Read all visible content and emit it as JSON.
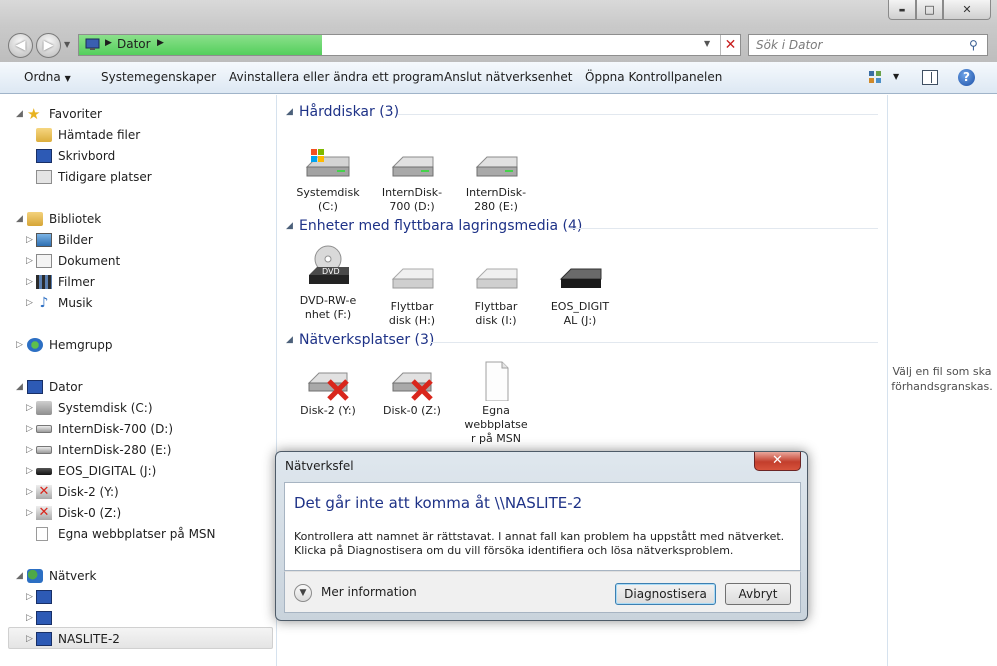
{
  "window": {
    "title": "",
    "buttons": {
      "minimize": "▬",
      "maximize": "□",
      "close": "✕"
    }
  },
  "address": {
    "path": [
      "Dator"
    ],
    "search_placeholder": "Sök i Dator"
  },
  "toolbar": {
    "organize": "Ordna",
    "items": [
      "Systemegenskaper",
      "Avinstallera eller ändra ett program",
      "Anslut nätverksenhet",
      "Öppna Kontrollpanelen"
    ]
  },
  "nav": {
    "favorites": {
      "label": "Favoriter",
      "items": [
        "Hämtade filer",
        "Skrivbord",
        "Tidigare platser"
      ]
    },
    "libraries": {
      "label": "Bibliotek",
      "items": [
        "Bilder",
        "Dokument",
        "Filmer",
        "Musik"
      ]
    },
    "homegroup": {
      "label": "Hemgrupp"
    },
    "computer": {
      "label": "Dator",
      "items": [
        "Systemdisk (C:)",
        "InternDisk-700 (D:)",
        "InternDisk-280 (E:)",
        "EOS_DIGITAL (J:)",
        "Disk-2 (Y:)",
        "Disk-0 (Z:)",
        "Egna webbplatser på MSN"
      ]
    },
    "network": {
      "label": "Nätverk",
      "items": [
        "",
        "",
        "NASLITE-2"
      ]
    }
  },
  "groups": {
    "harddisks": {
      "title": "Hårddiskar (3)",
      "items": [
        "Systemdisk (C:)",
        "InternDisk-700 (D:)",
        "InternDisk-280 (E:)"
      ]
    },
    "removable": {
      "title": "Enheter med flyttbara lagringsmedia (4)",
      "items": [
        "DVD-RW-enhet (F:)",
        "Flyttbar disk (H:)",
        "Flyttbar disk (I:)",
        "EOS_DIGITAL (J:)"
      ]
    },
    "network": {
      "title": "Nätverksplatser (3)",
      "items": [
        "Disk-2 (Y:)",
        "Disk-0 (Z:)",
        "Egna webbplatser på MSN"
      ]
    }
  },
  "items_display": {
    "c": [
      "Systemdisk",
      "(C:)"
    ],
    "d": [
      "InternDisk-",
      "700 (D:)"
    ],
    "e": [
      "InternDisk-",
      "280 (E:)"
    ],
    "f": [
      "DVD-RW-e",
      "nhet (F:)"
    ],
    "h": [
      "Flyttbar",
      "disk (H:)"
    ],
    "i": [
      "Flyttbar",
      "disk (I:)"
    ],
    "j": [
      "EOS_DIGIT",
      "AL (J:)"
    ],
    "y": [
      "Disk-2 (Y:)"
    ],
    "z": [
      "Disk-0 (Z:)"
    ],
    "msn": [
      "Egna",
      "webbplatse",
      "r på MSN"
    ]
  },
  "dvd_label": "DVD",
  "preview": {
    "text": "Välj en fil som ska förhandsgranskas."
  },
  "dialog": {
    "title": "Nätverksfel",
    "heading": "Det går inte att komma åt \\\\NASLITE-2",
    "message": "Kontrollera att namnet är rättstavat. I annat fall kan problem ha uppstått med nätverket. Klicka på Diagnostisera om du vill försöka identifiera och lösa nätverksproblem.",
    "more_info": "Mer information",
    "diagnose": "Diagnostisera",
    "cancel": "Avbryt"
  },
  "colors": {
    "accent": "#1e3287",
    "progress": "#5fd466",
    "error_red": "#d9261c"
  }
}
